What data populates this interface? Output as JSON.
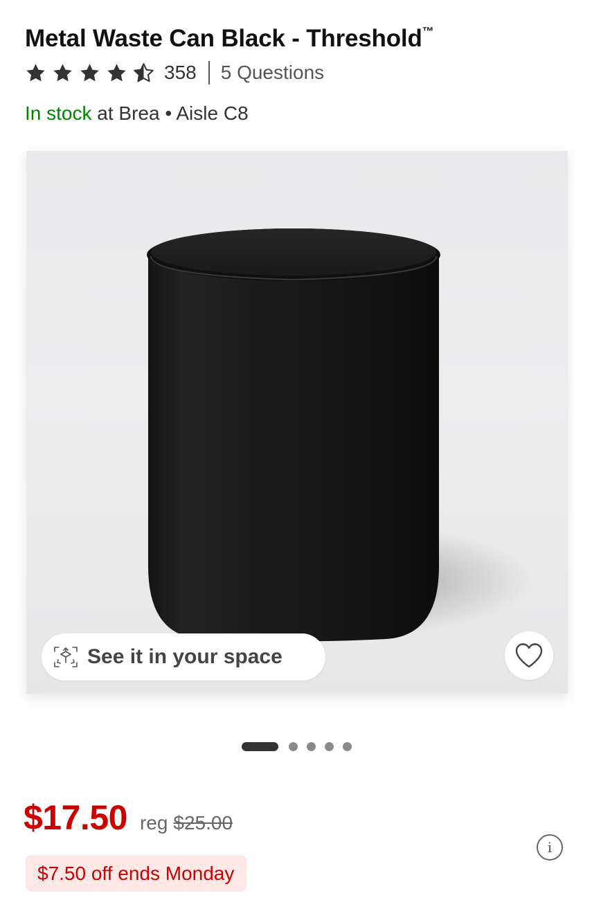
{
  "product": {
    "title": "Metal Waste Can Black - Threshold",
    "trademark": "™",
    "rating": 4.5,
    "rating_count": "358",
    "questions": "5 Questions"
  },
  "availability": {
    "status": "In stock",
    "location": "at Brea",
    "separator": "•",
    "aisle": "Aisle C8"
  },
  "gallery": {
    "ar_label": "See it in your space",
    "ar_icon": "ar-cube-icon",
    "favorite_icon": "heart-icon",
    "total_images": 5,
    "active_image": 1
  },
  "pricing": {
    "sale_price": "$17.50",
    "reg_label": "reg",
    "reg_price": "$25.00",
    "promo": "$7.50 off ends Monday",
    "info_icon": "info-icon",
    "info_glyph": "i"
  },
  "colors": {
    "price_red": "#cc0000",
    "stock_green": "#008300",
    "promo_bg": "#fde8e6"
  }
}
